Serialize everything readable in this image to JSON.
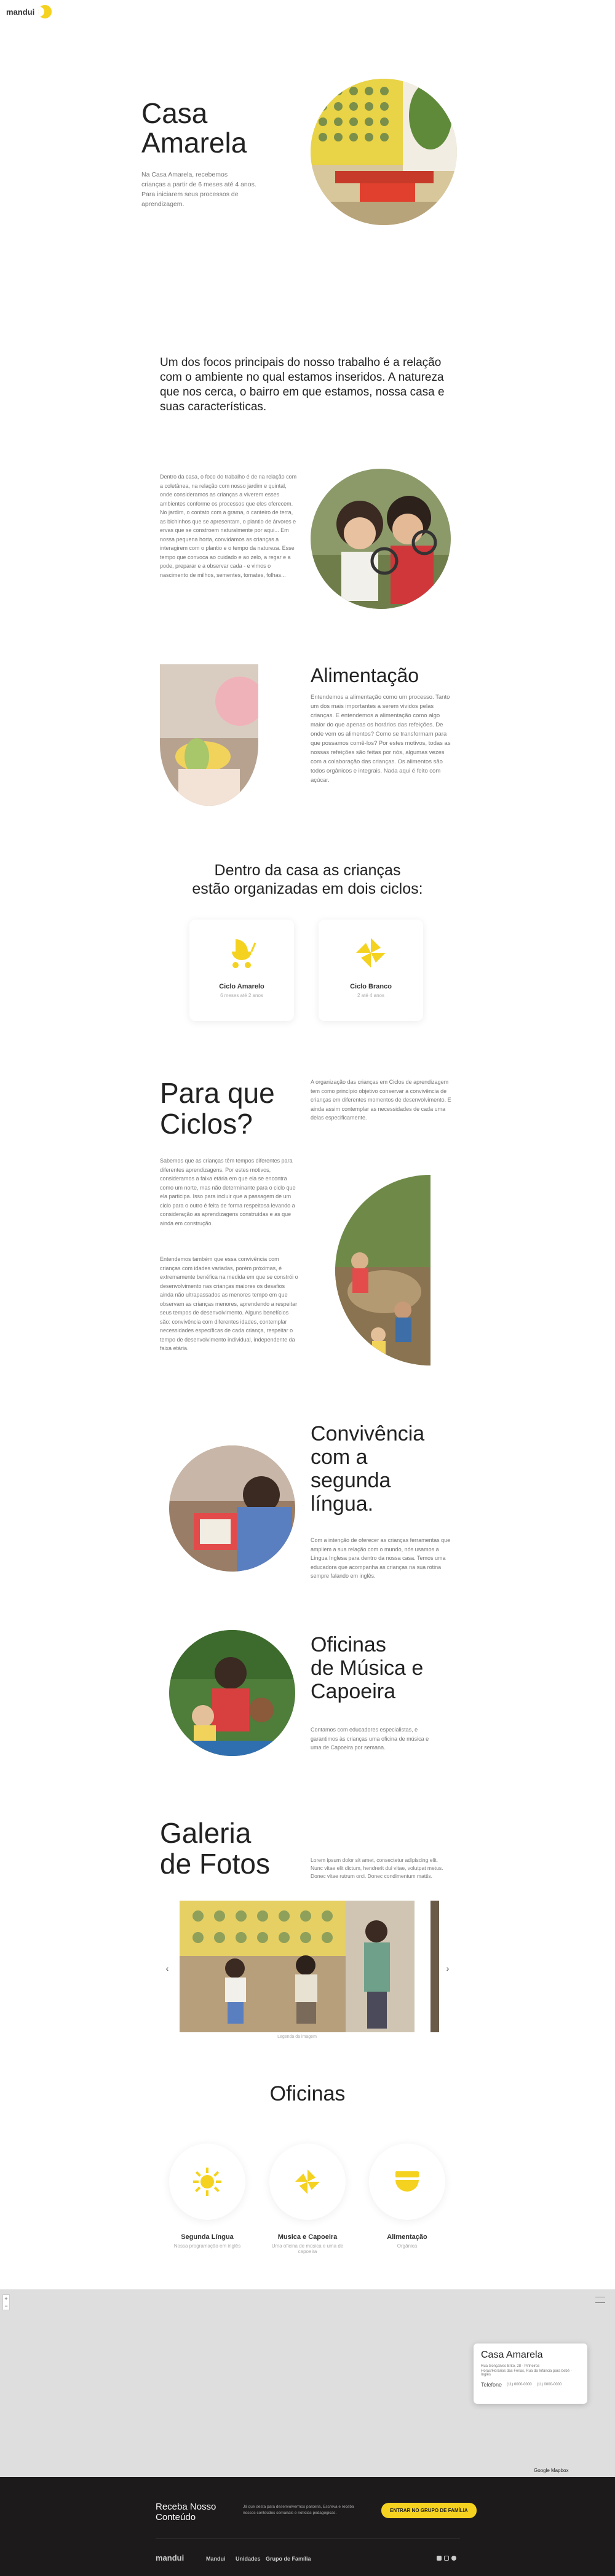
{
  "brand": {
    "logo_text": "mandui",
    "accent": "#f4d21f"
  },
  "hero": {
    "title_line1": "Casa",
    "title_line2": "Amarela",
    "desc_line1": "Na Casa Amarela, recebemos",
    "desc_line2": "crianças a partir de 6 meses até 4 anos.",
    "desc_line3": "Para iniciarem seus processos de aprendizagem."
  },
  "focus": {
    "heading": "Um dos focos principais do nosso trabalho é a relação com o ambiente no qual estamos inseridos. A natureza que nos cerca, o bairro em que estamos, nossa casa e suas características.",
    "text": "Dentro da casa, o foco do trabalho é de na relação com a coletânea, na relação com nosso jardim e quintal, onde consideramos as crianças a viverem esses ambientes conforme os processos que eles oferecem. No jardim, o contato com a grama, o canteiro de terra, as bichinhos que se apresentam, o plantio de árvores e ervas que se constroem naturalmente por aqui... Em nossa pequena horta, convidamos as crianças a interagirem com o plantio e o tempo da natureza. Esse tempo que convoca ao cuidado e ao zelo, a regar e a pode, preparar e a observar cada - e vimos o nascimento de milhos, sementes, tomates, folhas..."
  },
  "food": {
    "title": "Alimentação",
    "text": "Entendemos a alimentação como um processo. Tanto um dos mais importantes a serem vividos pelas crianças. E entendemos a alimentação como algo maior do que apenas os horários das refeições. De onde vem os alimentos? Como se transformam para que possamos comê-los? Por estes motivos, todas as nossas refeições são feitas por nós, algumas vezes com a colaboração das crianças. Os alimentos são todos orgânicos e integrais. Nada aqui é feito com açúcar."
  },
  "cycles": {
    "heading_line1": "Dentro da casa as crianças",
    "heading_line2": "estão organizadas em dois ciclos:",
    "items": [
      {
        "title": "Ciclo Amarelo",
        "sub": "6 meses até 2 anos"
      },
      {
        "title": "Ciclo Branco",
        "sub": "2 até 4 anos"
      }
    ]
  },
  "why": {
    "title_line1": "Para que",
    "title_line2": "Ciclos?",
    "intro": "A organização das crianças em Ciclos de aprendizagem tem como princípio objetivo conservar a convivência de crianças em diferentes momentos de desenvolvimento. E ainda assim contemplar as necessidades de cada uma delas especificamente.",
    "text1": "Sabemos que as crianças têm tempos diferentes para diferentes aprendizagens. Por estes motivos, consideramos a faixa etária em que ela se encontra como um norte, mas não determinante para o ciclo que ela participa. Isso para incluir que a passagem de um ciclo para o outro é feita de forma respeitosa levando a consideração as aprendizagens construídas e as que ainda em construção.",
    "text2": "Entendemos também que essa convivência com crianças com idades variadas, porém próximas, é extremamente benéfica na medida em que se constrói o desenvolvimento nas crianças maiores os desafios ainda não ultrapassados as menores tempo em que observam as crianças menores, aprendendo a respeitar seus tempos de desenvolvimento. Alguns benefícios são: convivência com diferentes idades, contemplar necessidades específicas de cada criança, respeitar o tempo de desenvolvimento individual, independente da faixa etária."
  },
  "language": {
    "title_line1": "Convivência",
    "title_line2": "com a",
    "title_line3": "segunda",
    "title_line4": "língua.",
    "text": "Com a intenção de oferecer as crianças ferramentas que ampliem a sua relação com o mundo, nós usamos a Língua Inglesa para dentro da nossa casa. Temos uma educadora que acompanha as crianças na sua rotina sempre falando em inglês."
  },
  "music": {
    "title_line1": "Oficinas",
    "title_line2": "de Música e",
    "title_line3": "Capoeira",
    "text": "Contamos com educadores especialistas, e garantimos às crianças uma oficina de música e uma de Capoeira por semana."
  },
  "gallery": {
    "title_line1": "Galeria",
    "title_line2": "de Fotos",
    "desc": "Lorem ipsum dolor sit amet, consectetur adipiscing elit. Nunc vitae elit dictum, hendrerit dui vitae, volutpat metus. Donec vitae rutrum orci. Donec condimentum mattis.",
    "caption": "Legenda da imagem"
  },
  "workshops": {
    "heading": "Oficinas",
    "items": [
      {
        "title": "Segunda Língua",
        "sub": "Nossa programação em inglês"
      },
      {
        "title": "Musica e Capoeira",
        "sub": "Uma oficina de música e uma de capoeira"
      },
      {
        "title": "Alimentação",
        "sub": "Orgânica"
      }
    ]
  },
  "map": {
    "zoom_plus": "+",
    "zoom_minus": "−",
    "card_title": "Casa Amarela",
    "card_address_line1": "Rua Gonçalves Brito, 28 - Pinheiros",
    "card_address_line2": "Horas/Horários das Férias, Rua da Infância para bebê - Inglês",
    "card_phone_label": "Telefone",
    "card_phone1": "(11) 0000-0000",
    "card_phone2": "(11) 0000-0000",
    "corner_label": "Google Mapbox"
  },
  "newsletter": {
    "title_line1": "Receba Nosso",
    "title_line2": "Conteúdo",
    "text": "Já que desta para desenvolvermos parceria, Escreva e receba nossos conteúdos semanais e notícias pedagógicas.",
    "button": "Entrar no grupo de família"
  },
  "footer": {
    "brand": "mandui",
    "links": [
      "Mandui",
      "Unidades",
      "Grupo de Família"
    ]
  }
}
